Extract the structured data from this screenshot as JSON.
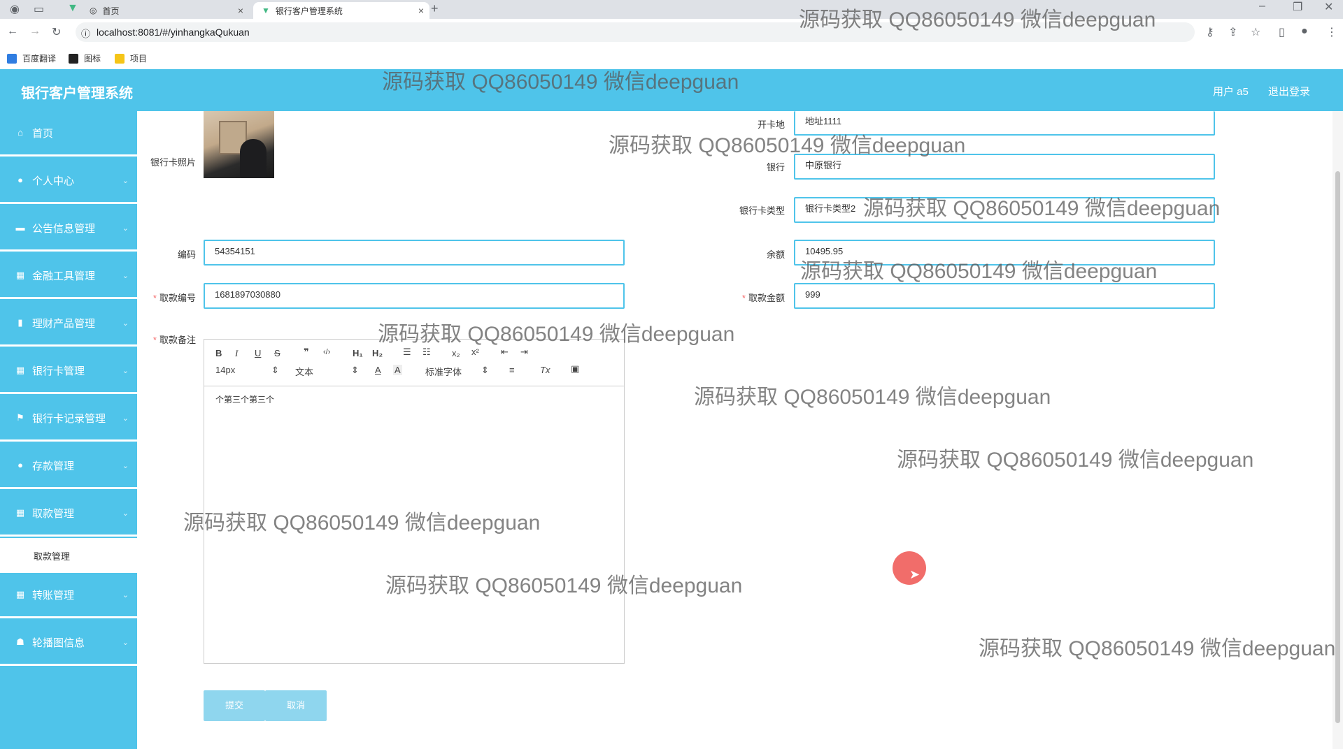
{
  "browser": {
    "tabs": [
      {
        "label": "首页",
        "icon": "globe-icon"
      },
      {
        "label": "银行客户管理系统",
        "icon": "vue-logo-icon"
      }
    ],
    "url": "localhost:8081/#/yinhangkaQukuan",
    "bookmarks": [
      "百度翻译",
      "图标",
      "项目"
    ]
  },
  "header": {
    "title": "银行客户管理系统",
    "user": "用户 a5",
    "logout": "退出登录"
  },
  "sidebar": {
    "items": [
      {
        "label": "首页",
        "icon": "home-icon"
      },
      {
        "label": "个人中心",
        "icon": "user-icon"
      },
      {
        "label": "公告信息管理",
        "icon": "notice-icon"
      },
      {
        "label": "金融工具管理",
        "icon": "grid-icon"
      },
      {
        "label": "理财产品管理",
        "icon": "chart-icon"
      },
      {
        "label": "银行卡管理",
        "icon": "grid-icon"
      },
      {
        "label": "银行卡记录管理",
        "icon": "flag-icon"
      },
      {
        "label": "存款管理",
        "icon": "user-icon"
      },
      {
        "label": "取款管理",
        "icon": "grid-icon"
      },
      {
        "label": "转账管理",
        "icon": "grid-icon"
      },
      {
        "label": "轮播图信息",
        "icon": "thumb-icon"
      }
    ],
    "sub_item": "取款管理"
  },
  "form": {
    "photo_label": "银行卡照片",
    "kaihu_label": "开卡地",
    "kaihu_value": "地址1111",
    "bank_label": "银行",
    "bank_value": "中原银行",
    "cardtype_label": "银行卡类型",
    "cardtype_value": "银行卡类型2",
    "code_label": "编码",
    "code_value": "54354151",
    "balance_label": "余额",
    "balance_value": "10495.95",
    "withdraw_no_label": "取款编号",
    "withdraw_no_value": "1681897030880",
    "amount_label": "取款金额",
    "amount_value": "999",
    "note_label": "取款备注",
    "editor": {
      "font_size": "14px",
      "text_type": "文本",
      "font_family": "标准字体",
      "content": "个第三个第三个"
    },
    "submit": "提交",
    "cancel": "取消"
  },
  "watermark": "源码获取 QQ86050149 微信deepguan"
}
